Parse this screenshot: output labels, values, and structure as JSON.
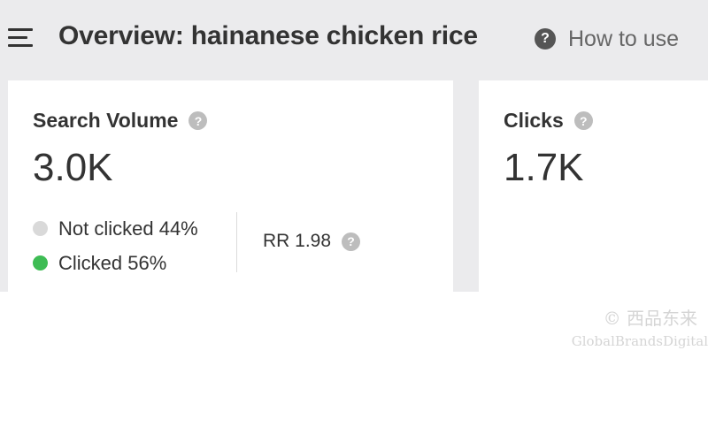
{
  "header": {
    "menu_icon": "hamburger-menu-icon",
    "title": "Overview: hainanese chicken rice",
    "help_icon_glyph": "?",
    "help_label": "How to use"
  },
  "cards": {
    "search_volume": {
      "title": "Search Volume",
      "help_glyph": "?",
      "value": "3.0K",
      "legend": [
        {
          "label": "Not clicked 44%",
          "color": "#d9d9d9",
          "percent": 44
        },
        {
          "label": "Clicked 56%",
          "color": "#3ebc54",
          "percent": 56
        }
      ],
      "rr_label": "RR 1.98",
      "rr_help_glyph": "?"
    },
    "clicks": {
      "title": "Clicks",
      "help_glyph": "?",
      "value": "1.7K"
    }
  },
  "watermark": {
    "line1": "© 西品东来",
    "line2": "GlobalBrandsDigital"
  },
  "colors": {
    "background": "#ebebed",
    "card": "#ffffff",
    "text": "#333333",
    "clicked": "#3ebc54",
    "not_clicked": "#d9d9d9"
  }
}
